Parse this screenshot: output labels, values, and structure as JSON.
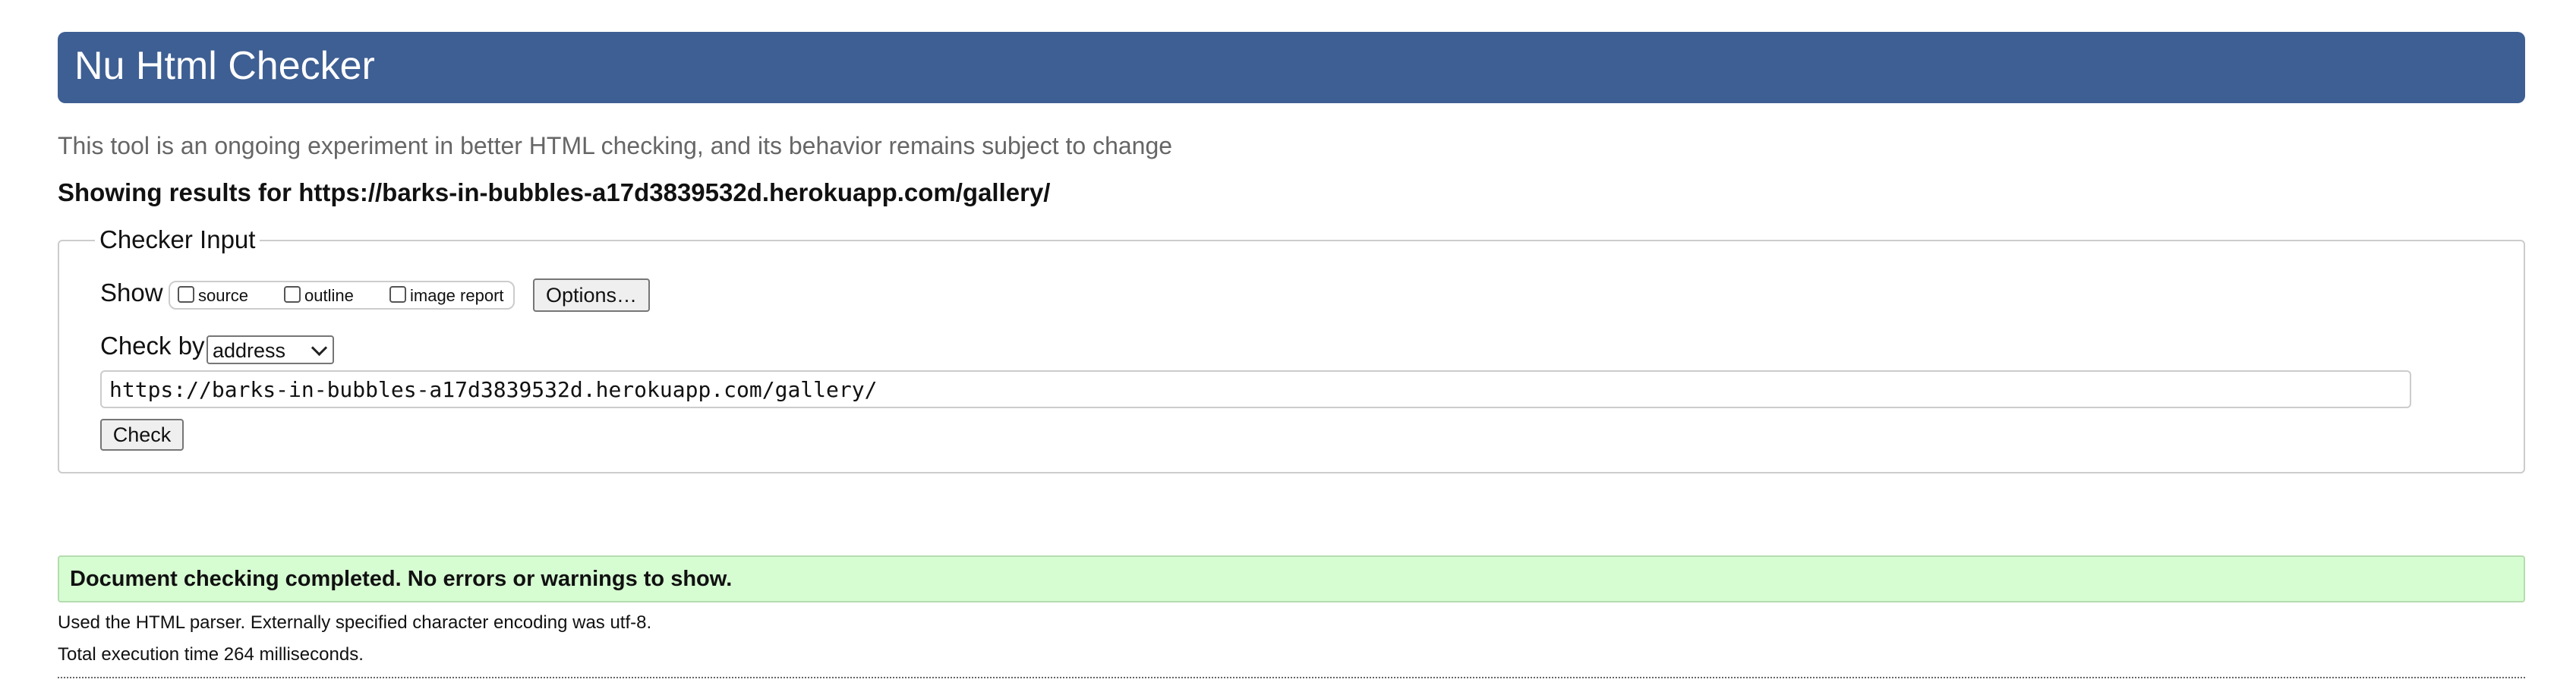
{
  "header": {
    "title": "Nu Html Checker"
  },
  "intro": "This tool is an ongoing experiment in better HTML checking, and its behavior remains subject to change",
  "results_for": "Showing results for https://barks-in-bubbles-a17d3839532d.herokuapp.com/gallery/",
  "checker_input": {
    "legend": "Checker Input",
    "show_label": "Show",
    "show_options": [
      {
        "label": "source",
        "checked": false
      },
      {
        "label": "outline",
        "checked": false
      },
      {
        "label": "image report",
        "checked": false
      }
    ],
    "options_button": "Options…",
    "check_by_label": "Check by",
    "check_by_selected": "address",
    "url_value": "https://barks-in-bubbles-a17d3839532d.herokuapp.com/gallery/",
    "check_button": "Check"
  },
  "result": {
    "message": "Document checking completed. No errors or warnings to show.",
    "parser_info": "Used the HTML parser. Externally specified character encoding was utf-8.",
    "execution_time": "Total execution time 264 milliseconds."
  },
  "colors": {
    "header_bg": "#3e5f93",
    "success_bg": "#d6fcd2"
  }
}
